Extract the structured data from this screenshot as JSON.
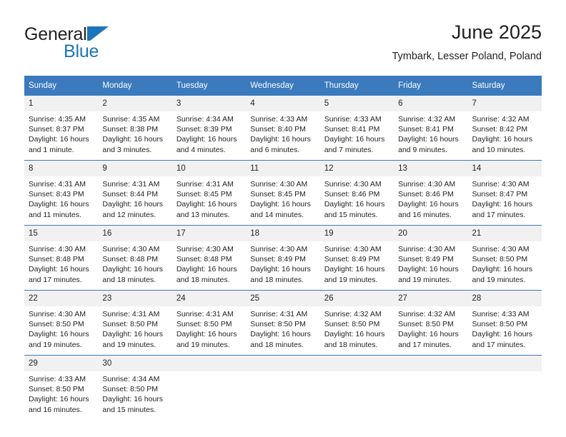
{
  "brand": {
    "name_part1": "General",
    "name_part2": "Blue",
    "logo_icon": "triangle-logo-icon",
    "accent_color": "#1b75bc"
  },
  "header": {
    "title": "June 2025",
    "location": "Tymbark, Lesser Poland, Poland"
  },
  "theme": {
    "header_blue": "#3a7abd",
    "daynum_gray": "#f1f1f1",
    "text_color": "#231f20"
  },
  "calendar": {
    "weekday_headers": [
      "Sunday",
      "Monday",
      "Tuesday",
      "Wednesday",
      "Thursday",
      "Friday",
      "Saturday"
    ],
    "weeks": [
      [
        {
          "day": "1",
          "sunrise": "Sunrise: 4:35 AM",
          "sunset": "Sunset: 8:37 PM",
          "daylight_line1": "Daylight: 16 hours",
          "daylight_line2": "and 1 minute."
        },
        {
          "day": "2",
          "sunrise": "Sunrise: 4:35 AM",
          "sunset": "Sunset: 8:38 PM",
          "daylight_line1": "Daylight: 16 hours",
          "daylight_line2": "and 3 minutes."
        },
        {
          "day": "3",
          "sunrise": "Sunrise: 4:34 AM",
          "sunset": "Sunset: 8:39 PM",
          "daylight_line1": "Daylight: 16 hours",
          "daylight_line2": "and 4 minutes."
        },
        {
          "day": "4",
          "sunrise": "Sunrise: 4:33 AM",
          "sunset": "Sunset: 8:40 PM",
          "daylight_line1": "Daylight: 16 hours",
          "daylight_line2": "and 6 minutes."
        },
        {
          "day": "5",
          "sunrise": "Sunrise: 4:33 AM",
          "sunset": "Sunset: 8:41 PM",
          "daylight_line1": "Daylight: 16 hours",
          "daylight_line2": "and 7 minutes."
        },
        {
          "day": "6",
          "sunrise": "Sunrise: 4:32 AM",
          "sunset": "Sunset: 8:41 PM",
          "daylight_line1": "Daylight: 16 hours",
          "daylight_line2": "and 9 minutes."
        },
        {
          "day": "7",
          "sunrise": "Sunrise: 4:32 AM",
          "sunset": "Sunset: 8:42 PM",
          "daylight_line1": "Daylight: 16 hours",
          "daylight_line2": "and 10 minutes."
        }
      ],
      [
        {
          "day": "8",
          "sunrise": "Sunrise: 4:31 AM",
          "sunset": "Sunset: 8:43 PM",
          "daylight_line1": "Daylight: 16 hours",
          "daylight_line2": "and 11 minutes."
        },
        {
          "day": "9",
          "sunrise": "Sunrise: 4:31 AM",
          "sunset": "Sunset: 8:44 PM",
          "daylight_line1": "Daylight: 16 hours",
          "daylight_line2": "and 12 minutes."
        },
        {
          "day": "10",
          "sunrise": "Sunrise: 4:31 AM",
          "sunset": "Sunset: 8:45 PM",
          "daylight_line1": "Daylight: 16 hours",
          "daylight_line2": "and 13 minutes."
        },
        {
          "day": "11",
          "sunrise": "Sunrise: 4:30 AM",
          "sunset": "Sunset: 8:45 PM",
          "daylight_line1": "Daylight: 16 hours",
          "daylight_line2": "and 14 minutes."
        },
        {
          "day": "12",
          "sunrise": "Sunrise: 4:30 AM",
          "sunset": "Sunset: 8:46 PM",
          "daylight_line1": "Daylight: 16 hours",
          "daylight_line2": "and 15 minutes."
        },
        {
          "day": "13",
          "sunrise": "Sunrise: 4:30 AM",
          "sunset": "Sunset: 8:46 PM",
          "daylight_line1": "Daylight: 16 hours",
          "daylight_line2": "and 16 minutes."
        },
        {
          "day": "14",
          "sunrise": "Sunrise: 4:30 AM",
          "sunset": "Sunset: 8:47 PM",
          "daylight_line1": "Daylight: 16 hours",
          "daylight_line2": "and 17 minutes."
        }
      ],
      [
        {
          "day": "15",
          "sunrise": "Sunrise: 4:30 AM",
          "sunset": "Sunset: 8:48 PM",
          "daylight_line1": "Daylight: 16 hours",
          "daylight_line2": "and 17 minutes."
        },
        {
          "day": "16",
          "sunrise": "Sunrise: 4:30 AM",
          "sunset": "Sunset: 8:48 PM",
          "daylight_line1": "Daylight: 16 hours",
          "daylight_line2": "and 18 minutes."
        },
        {
          "day": "17",
          "sunrise": "Sunrise: 4:30 AM",
          "sunset": "Sunset: 8:48 PM",
          "daylight_line1": "Daylight: 16 hours",
          "daylight_line2": "and 18 minutes."
        },
        {
          "day": "18",
          "sunrise": "Sunrise: 4:30 AM",
          "sunset": "Sunset: 8:49 PM",
          "daylight_line1": "Daylight: 16 hours",
          "daylight_line2": "and 18 minutes."
        },
        {
          "day": "19",
          "sunrise": "Sunrise: 4:30 AM",
          "sunset": "Sunset: 8:49 PM",
          "daylight_line1": "Daylight: 16 hours",
          "daylight_line2": "and 19 minutes."
        },
        {
          "day": "20",
          "sunrise": "Sunrise: 4:30 AM",
          "sunset": "Sunset: 8:49 PM",
          "daylight_line1": "Daylight: 16 hours",
          "daylight_line2": "and 19 minutes."
        },
        {
          "day": "21",
          "sunrise": "Sunrise: 4:30 AM",
          "sunset": "Sunset: 8:50 PM",
          "daylight_line1": "Daylight: 16 hours",
          "daylight_line2": "and 19 minutes."
        }
      ],
      [
        {
          "day": "22",
          "sunrise": "Sunrise: 4:30 AM",
          "sunset": "Sunset: 8:50 PM",
          "daylight_line1": "Daylight: 16 hours",
          "daylight_line2": "and 19 minutes."
        },
        {
          "day": "23",
          "sunrise": "Sunrise: 4:31 AM",
          "sunset": "Sunset: 8:50 PM",
          "daylight_line1": "Daylight: 16 hours",
          "daylight_line2": "and 19 minutes."
        },
        {
          "day": "24",
          "sunrise": "Sunrise: 4:31 AM",
          "sunset": "Sunset: 8:50 PM",
          "daylight_line1": "Daylight: 16 hours",
          "daylight_line2": "and 19 minutes."
        },
        {
          "day": "25",
          "sunrise": "Sunrise: 4:31 AM",
          "sunset": "Sunset: 8:50 PM",
          "daylight_line1": "Daylight: 16 hours",
          "daylight_line2": "and 18 minutes."
        },
        {
          "day": "26",
          "sunrise": "Sunrise: 4:32 AM",
          "sunset": "Sunset: 8:50 PM",
          "daylight_line1": "Daylight: 16 hours",
          "daylight_line2": "and 18 minutes."
        },
        {
          "day": "27",
          "sunrise": "Sunrise: 4:32 AM",
          "sunset": "Sunset: 8:50 PM",
          "daylight_line1": "Daylight: 16 hours",
          "daylight_line2": "and 17 minutes."
        },
        {
          "day": "28",
          "sunrise": "Sunrise: 4:33 AM",
          "sunset": "Sunset: 8:50 PM",
          "daylight_line1": "Daylight: 16 hours",
          "daylight_line2": "and 17 minutes."
        }
      ],
      [
        {
          "day": "29",
          "sunrise": "Sunrise: 4:33 AM",
          "sunset": "Sunset: 8:50 PM",
          "daylight_line1": "Daylight: 16 hours",
          "daylight_line2": "and 16 minutes."
        },
        {
          "day": "30",
          "sunrise": "Sunrise: 4:34 AM",
          "sunset": "Sunset: 8:50 PM",
          "daylight_line1": "Daylight: 16 hours",
          "daylight_line2": "and 15 minutes."
        },
        {
          "day": "",
          "sunrise": "",
          "sunset": "",
          "daylight_line1": "",
          "daylight_line2": "",
          "empty": true
        },
        {
          "day": "",
          "sunrise": "",
          "sunset": "",
          "daylight_line1": "",
          "daylight_line2": "",
          "empty": true
        },
        {
          "day": "",
          "sunrise": "",
          "sunset": "",
          "daylight_line1": "",
          "daylight_line2": "",
          "empty": true
        },
        {
          "day": "",
          "sunrise": "",
          "sunset": "",
          "daylight_line1": "",
          "daylight_line2": "",
          "empty": true
        },
        {
          "day": "",
          "sunrise": "",
          "sunset": "",
          "daylight_line1": "",
          "daylight_line2": "",
          "empty": true
        }
      ]
    ]
  }
}
